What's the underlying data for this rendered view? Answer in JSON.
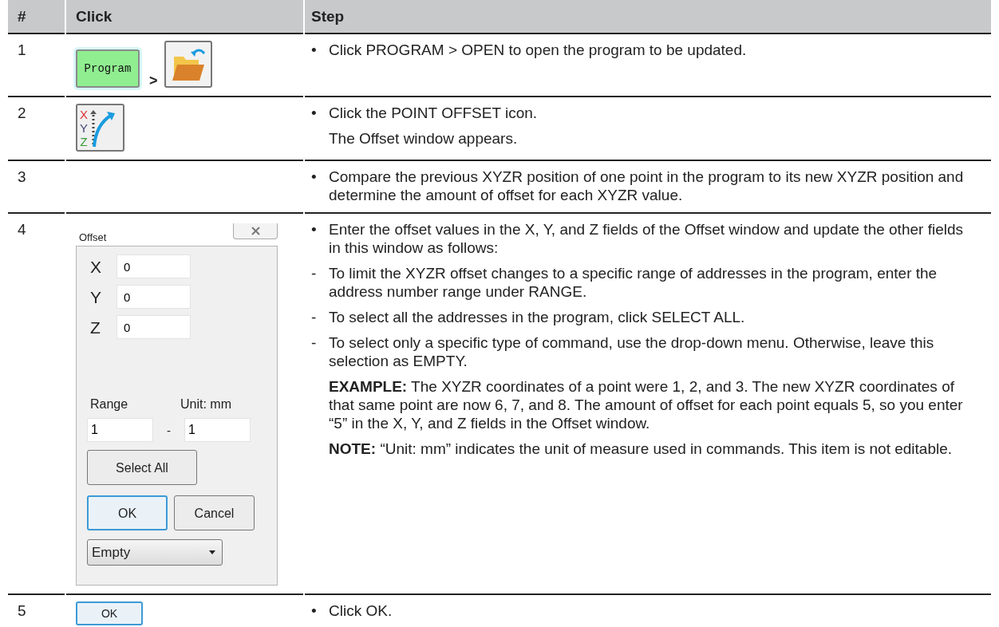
{
  "table": {
    "columns": [
      "#",
      "Click",
      "Step"
    ],
    "rows": [
      {
        "number": "1",
        "click": [
          {
            "kind": "program-button",
            "label": "Program"
          },
          {
            "kind": "separator",
            "text": ">"
          },
          {
            "kind": "folder-button"
          }
        ],
        "steps": [
          {
            "kind": "bullet",
            "marker": "•",
            "text": "Click PROGRAM > OPEN to open the program to be updated."
          }
        ]
      },
      {
        "number": "2",
        "click": [
          {
            "kind": "offset-button",
            "letters": [
              "X",
              "Y",
              "Z"
            ]
          }
        ],
        "steps": [
          {
            "kind": "bullet",
            "marker": "•",
            "text": "Click the POINT OFFSET icon."
          },
          {
            "kind": "text",
            "text": "The Offset window appears."
          }
        ]
      },
      {
        "number": "3",
        "click": [],
        "steps": [
          {
            "kind": "bullet",
            "marker": "•",
            "text": "Compare the previous XYZR position of one point in the program to its new XYZR position and determine the amount of offset for each XYZR value."
          }
        ]
      },
      {
        "number": "4",
        "click": [
          {
            "kind": "dialog",
            "title": "Offset",
            "fields": [
              {
                "label": "X",
                "value": "0"
              },
              {
                "label": "Y",
                "value": "0"
              },
              {
                "label": "Z",
                "value": "0"
              }
            ],
            "range_label": "Range",
            "unit_label": "Unit: mm",
            "range_from": "1",
            "range_dash": "-",
            "range_to": "1",
            "buttons": [
              {
                "label": "Select All",
                "default": false
              },
              {
                "label": "OK",
                "default": true
              },
              {
                "label": "Cancel",
                "default": false
              }
            ],
            "select_value": "Empty"
          }
        ],
        "steps": [
          {
            "kind": "bullet",
            "marker": "•",
            "text": "Enter the offset values in the X, Y, and Z fields of the Offset window and update the other fields in this window as follows:"
          },
          {
            "kind": "dash",
            "marker": "-",
            "text": "To limit the XYZR offset changes to a specific range of addresses in the program, enter the address number range under RANGE."
          },
          {
            "kind": "dash",
            "marker": "-",
            "text": "To select all the addresses in the program, click SELECT ALL."
          },
          {
            "kind": "dash",
            "marker": "-",
            "text": "To select only a specific type of command, use the drop-down menu. Otherwise, leave this selection as EMPTY."
          },
          {
            "kind": "text",
            "text": "**EXAMPLE:** The XYZR coordinates of a point were 1, 2, and 3. The new XYZR coordinates of that same point are now 6, 7, and 8. The amount of offset for each point equals 5, so you enter “5” in the X, Y, and Z fields in the Offset window."
          },
          {
            "kind": "text",
            "text": "**NOTE:** “Unit: mm” indicates the unit of measure used in commands. This item is not editable."
          }
        ]
      },
      {
        "number": "5",
        "click": [
          {
            "kind": "button",
            "label": "OK",
            "default": true
          }
        ],
        "steps": [
          {
            "kind": "bullet",
            "marker": "•",
            "text": "Click OK."
          }
        ]
      }
    ]
  }
}
